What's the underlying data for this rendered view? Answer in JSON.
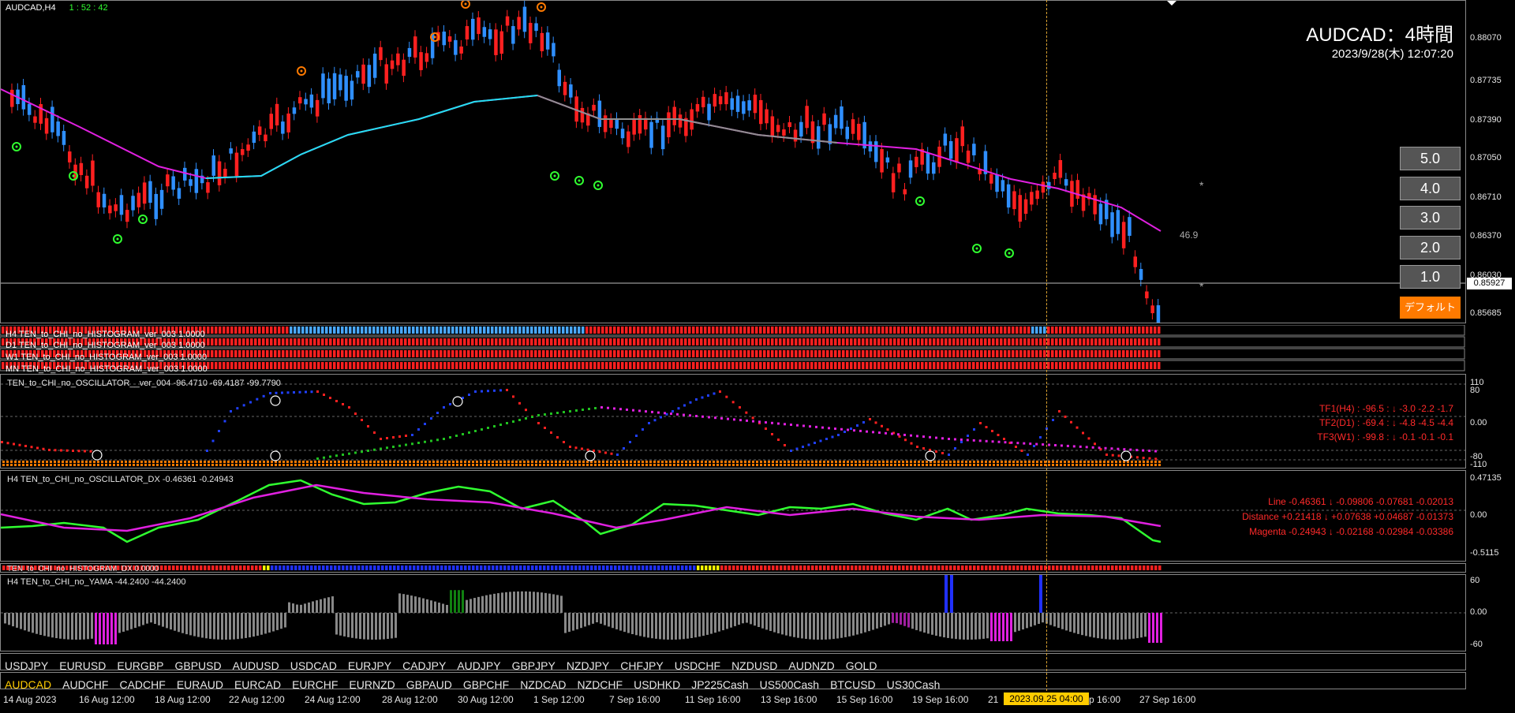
{
  "main": {
    "symbol": "AUDCAD,H4",
    "countdown": "1 : 52 : 42",
    "big_title": "AUDCAD：4時間",
    "datetime": "2023/9/28(木) 12:07:20",
    "current_price": "0.85927",
    "value_label": "46.9",
    "asterisk": "*",
    "prices": [
      "0.88070",
      "0.87735",
      "0.87390",
      "0.87050",
      "0.86710",
      "0.86370",
      "0.86030",
      "0.85685"
    ],
    "tf_buttons": [
      "5.0",
      "4.0",
      "3.0",
      "2.0",
      "1.0"
    ],
    "default_button": "デフォルト"
  },
  "histograms": [
    "H4 TEN_to_CHI_no_HISTOGRAM_ver_003 1.0000",
    "D1 TEN_to_CHI_no_HISTOGRAM_ver_003 1.0000",
    "W1 TEN_to_CHI_no_HISTOGRAM_ver_003 1.0000",
    "MN TEN_to_CHI_no_HISTOGRAM_ver_003 1.0000"
  ],
  "oscillator": {
    "title": "TEN_to_CHI_no_OSCILLATOR__ver_004 -96.4710 -69.4187 -99.7790",
    "rows": [
      "TF1(H4) : -96.5 : ↓ -3.0 -2.2 -1.7",
      "TF2(D1) : -69.4 : ↓ -4.8 -4.5 -4.4",
      "TF3(W1) : -99.8 : ↓ -0.1 -0.1 -0.1"
    ],
    "scale": [
      "110",
      "80",
      "0.00",
      "-80",
      "-110"
    ]
  },
  "dx": {
    "title": "H4 TEN_to_CHI_no_OSCILLATOR_DX -0.46361 -0.24943",
    "rows": [
      "Line -0.46361 ↓ -0.09806 -0.07681 -0.02013",
      "Distance +0.21418 ↓ +0.07638 +0.04687 -0.01373",
      "Magenta -0.24943 ↓ -0.02168 -0.02984 -0.03386"
    ],
    "scale": [
      "0.47135",
      "0.00",
      "-0.5115"
    ]
  },
  "hist_dx": {
    "title": "TEN_to_CHI_no_HISTOGRAM_DX 0.0000"
  },
  "yama": {
    "title": "H4 TEN_to_CHI_no_YAMA -44.2400 -44.2400",
    "scale": [
      "60",
      "0.00",
      "-60"
    ]
  },
  "symbols_row1": [
    "USDJPY",
    "EURUSD",
    "EURGBP",
    "GBPUSD",
    "AUDUSD",
    "USDCAD",
    "EURJPY",
    "CADJPY",
    "AUDJPY",
    "GBPJPY",
    "NZDJPY",
    "CHFJPY",
    "USDCHF",
    "NZDUSD",
    "AUDNZD",
    "GOLD"
  ],
  "symbols_row2": [
    "AUDCAD",
    "AUDCHF",
    "CADCHF",
    "EURAUD",
    "EURCAD",
    "EURCHF",
    "EURNZD",
    "GBPAUD",
    "GBPCHF",
    "NZDCAD",
    "NZDCHF",
    "USDHKD",
    "JP225Cash",
    "US500Cash",
    "BTCUSD",
    "US30Cash"
  ],
  "date_axis": [
    "14 Aug 2023",
    "16 Aug 12:00",
    "18 Aug 12:00",
    "22 Aug 12:00",
    "24 Aug 12:00",
    "28 Aug 12:00",
    "30 Aug 12:00",
    "1 Sep 12:00",
    "7 Sep 16:00",
    "11 Sep 16:00",
    "13 Sep 16:00",
    "15 Sep 16:00",
    "19 Sep 16:00",
    "21",
    "p 16:00",
    "27 Sep 16:00"
  ],
  "cursor_date": "2023.09.25 04:00",
  "colors": {
    "bull": "#2f8fff",
    "bear": "#ff2020",
    "magenta": "#e020e0",
    "cyan": "#22e0f0",
    "gray": "#909090",
    "orange": "#ff7a00",
    "green": "#30ff30"
  }
}
